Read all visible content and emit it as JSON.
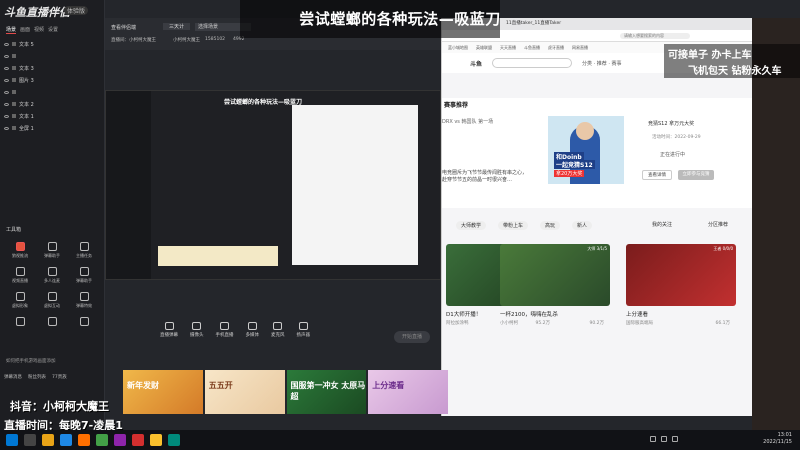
{
  "overlay": {
    "main_title": "尝试螳螂的各种玩法—吸蓝刀",
    "promo_line1": "可接单子 办卡上车",
    "promo_line2": "飞机包天 钻粉永久车",
    "handle": "抖音：小柯柯大魔王",
    "schedule": "直播时间：每晚7-凌晨1"
  },
  "app": {
    "name": "斗鱼直播伴侣",
    "badge": "体验版"
  },
  "side_tabs": [
    "场景",
    "画面",
    "视频",
    "设置"
  ],
  "layers": [
    "文本 5",
    "",
    "文本 3",
    "图片 3",
    "",
    "文本 2",
    "文本 1",
    "全屏 1"
  ],
  "tools": {
    "title": "工具箱",
    "items": [
      "狼视推流",
      "弹幕助手",
      "主播任务",
      "视频直播",
      "多人连麦",
      "弹幕助手",
      "虚拟形象",
      "虚拟互动",
      "弹幕特效",
      "",
      "",
      ""
    ]
  },
  "notice": "如何把手机游戏画面添加",
  "bottom_tabs": [
    "弹幕消息",
    "粉丝列表",
    "77贵族"
  ],
  "topbar": {
    "t1": "查看伴侣端",
    "t2": "三天计",
    "t3": "场景",
    "t3b": "选择场景",
    "row2_a": "直播间：小柯柯大魔王",
    "row2_b": "小柯柯大魔王",
    "row2_c": "1585102",
    "row2_d": "4992"
  },
  "preview": {
    "mini_title": "尝试螳螂的各种玩法—吸蓝刀"
  },
  "controls": [
    {
      "label": "直播弹幕",
      "icon": "danmu-icon"
    },
    {
      "label": "摄像头",
      "icon": "camera-icon"
    },
    {
      "label": "手机直播",
      "icon": "phone-icon"
    },
    {
      "label": "多媒体",
      "icon": "media-icon"
    },
    {
      "label": "麦克风",
      "icon": "mic-icon"
    },
    {
      "label": "扬声器",
      "icon": "speaker-icon"
    }
  ],
  "start_button": "开始直播",
  "browser": {
    "tab": "11直播taker_11直播Taker",
    "url": "请输入想要搜索的内容",
    "bookmarks": [
      "蓝小城地图",
      "英雄联盟",
      "天天直播",
      "斗鱼直播",
      "虎牙直播",
      "网易直播"
    ],
    "logo": "斗鱼",
    "nav": "分类 · 推荐 · 赛事",
    "section_title": "赛事推荐",
    "desc": "DRX vs 韩国队 第一场",
    "desc2": "电竞圈斥为飞节节最传闻胜有串之心，赴穿节节五的前晶一时很兴奋…",
    "poster_caption1": "和Doinb",
    "poster_caption2": "一起竞猜S12",
    "poster_caption3": "拿20万大奖",
    "event": "竞猜S12 拿万元大奖",
    "event_date": "活动时间：2022-09-29",
    "status": "正在进行中",
    "btn1": "查看详情",
    "btn2": "立即参与竞猜",
    "filters": [
      "大师教学",
      "带粉上车",
      "高玩",
      "新人"
    ],
    "filter_right": "我的关注",
    "filter_right2": "分区推荐"
  },
  "cards": [
    {
      "title": "D1大师开播！",
      "author": "阿拉加涂鸭",
      "views": "95.2万",
      "tag": "大师 12/8/5"
    },
    {
      "title": "一杯2100，嗨嗨在乱杀",
      "author": "小小柯柯",
      "views": "90.2万",
      "tag": "大师 3/1/5"
    },
    {
      "title": "上分速看",
      "author": "国际服高端局",
      "views": "66.1万",
      "tag": "王者 0/0/0"
    }
  ],
  "bottom_banner": [
    "新年发财",
    "五五开",
    "国服第一冲女 太原马超",
    "上分速看"
  ],
  "taskbar": {
    "time": "13:01",
    "date": "2022/11/15"
  },
  "colors": {
    "accent": "#e5533d",
    "panel": "#1d1e22",
    "browser_bg": "#f5f5f7"
  }
}
